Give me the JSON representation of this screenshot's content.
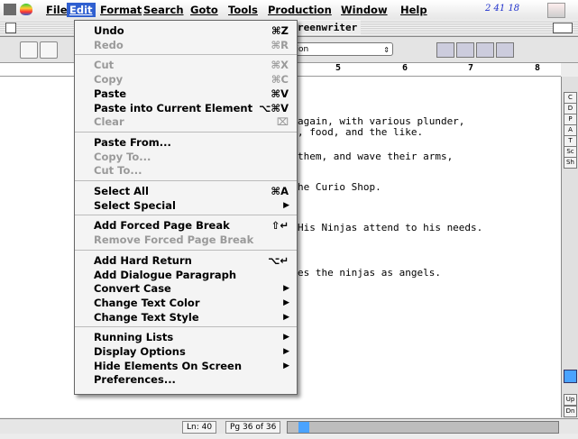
{
  "menubar": {
    "items": [
      "File",
      "Edit",
      "Format",
      "Search",
      "Goto",
      "Tools",
      "Production",
      "Window",
      "Help"
    ],
    "active": "Edit",
    "clock": "2 41 18"
  },
  "window": {
    "title": "reenwriter",
    "dropdown_value": "tion",
    "dropdown_arrows": "⇕"
  },
  "ruler": {
    "numbers": [
      "5",
      "6",
      "7",
      "8"
    ]
  },
  "script_lines": [
    "again, with various plunder,",
    ", food, and the like.",
    "them, and wave their arms,",
    "he Curio Shop.",
    "His Ninjas attend to his needs.",
    "es the ninjas as angels."
  ],
  "rightbar": {
    "buttons": [
      "C",
      "D",
      "P",
      "A",
      "T",
      "Sc",
      "Sh"
    ],
    "up_label": "Up",
    "dn_label": "Dn"
  },
  "status": {
    "line": "Ln:  40",
    "page": "Pg 36 of 36"
  },
  "edit_menu": {
    "groups": [
      [
        {
          "label": "Undo",
          "shortcut": "⌘Z",
          "enabled": true
        },
        {
          "label": "Redo",
          "shortcut": "⌘R",
          "enabled": false
        }
      ],
      [
        {
          "label": "Cut",
          "shortcut": "⌘X",
          "enabled": false
        },
        {
          "label": "Copy",
          "shortcut": "⌘C",
          "enabled": false
        },
        {
          "label": "Paste",
          "shortcut": "⌘V",
          "enabled": true
        },
        {
          "label": "Paste into Current Element",
          "shortcut": "⌥⌘V",
          "enabled": true
        },
        {
          "label": "Clear",
          "shortcut": "⌧",
          "enabled": false
        }
      ],
      [
        {
          "label": "Paste From...",
          "enabled": true
        },
        {
          "label": "Copy To...",
          "enabled": false
        },
        {
          "label": "Cut To...",
          "enabled": false
        }
      ],
      [
        {
          "label": "Select All",
          "shortcut": "⌘A",
          "enabled": true
        },
        {
          "label": "Select Special",
          "submenu": true,
          "enabled": true
        }
      ],
      [
        {
          "label": "Add Forced Page Break",
          "shortcut": "⇧↵",
          "enabled": true
        },
        {
          "label": "Remove Forced Page Break",
          "enabled": false
        }
      ],
      [
        {
          "label": "Add Hard Return",
          "shortcut": "⌥↵",
          "enabled": true
        },
        {
          "label": "Add Dialogue Paragraph",
          "enabled": true
        },
        {
          "label": "Convert Case",
          "submenu": true,
          "enabled": true
        },
        {
          "label": "Change Text Color",
          "submenu": true,
          "enabled": true
        },
        {
          "label": "Change Text Style",
          "submenu": true,
          "enabled": true
        }
      ],
      [
        {
          "label": "Running Lists",
          "submenu": true,
          "enabled": true
        },
        {
          "label": "Display Options",
          "submenu": true,
          "enabled": true
        },
        {
          "label": "Hide Elements On Screen",
          "submenu": true,
          "enabled": true
        },
        {
          "label": "Preferences...",
          "enabled": true
        }
      ]
    ]
  }
}
